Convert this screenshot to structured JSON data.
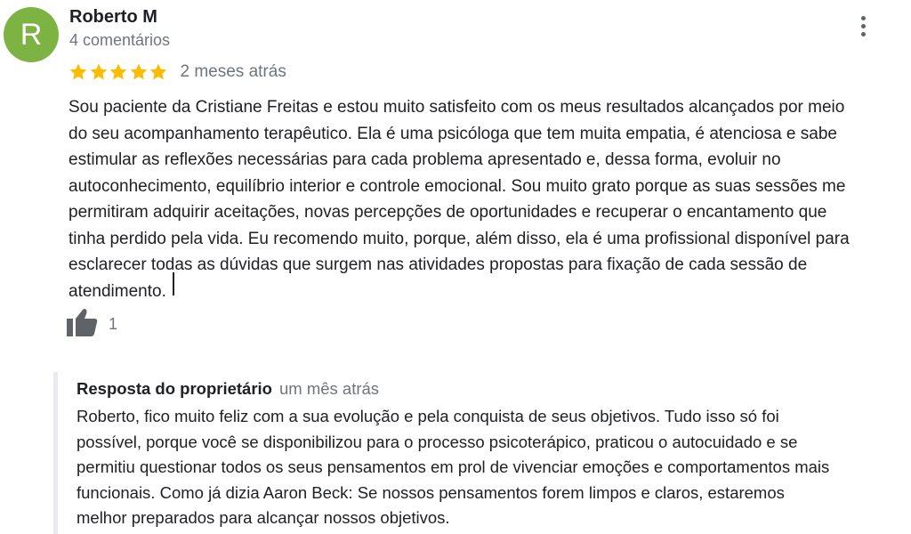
{
  "reviewer": {
    "initial": "R",
    "name": "Roberto M",
    "review_count": "4 comentários",
    "avatar_color": "#7cb342"
  },
  "menu": {
    "icon": "more-vert-icon"
  },
  "review": {
    "rating": 5,
    "max_rating": 5,
    "star_color": "#fbbc04",
    "time": "2 meses atrás",
    "text": "Sou paciente da Cristiane Freitas e estou muito satisfeito com os meus resultados alcançados por meio\ndo seu acompanhamento terapêutico. Ela é uma psicóloga que tem muita empatia, é atenciosa e sabe\nestimular as reflexões necessárias para cada problema apresentado e, dessa forma, evoluir no\nautoconhecimento, equilíbrio interior e controle emocional. Sou muito grato porque as suas sessões me\npermitiram adquirir aceitações, novas percepções de oportunidades e recuperar o encantamento que\ntinha perdido pela vida. Eu recomendo muito, porque, além disso, ela é uma profissional disponível para\nesclarecer todas as dúvidas que surgem nas atividades propostas para fixação de cada sessão de\natendimento."
  },
  "likes": {
    "icon": "thumbs-up-icon",
    "count": "1"
  },
  "owner_reply": {
    "title": "Resposta do proprietário",
    "time": "um mês atrás",
    "text": "Roberto, fico muito feliz com a sua evolução e pela conquista de seus objetivos. Tudo isso só foi\npossível, porque você se disponibilizou para o processo psicoterápico, praticou o autocuidado e se\npermitiu questionar todos os seus pensamentos em prol de vivenciar emoções e comportamentos mais\nfuncionais. Como já dizia Aaron Beck: Se nossos pensamentos forem limpos e claros, estaremos\nmelhor preparados para alcançar nossos objetivos."
  }
}
